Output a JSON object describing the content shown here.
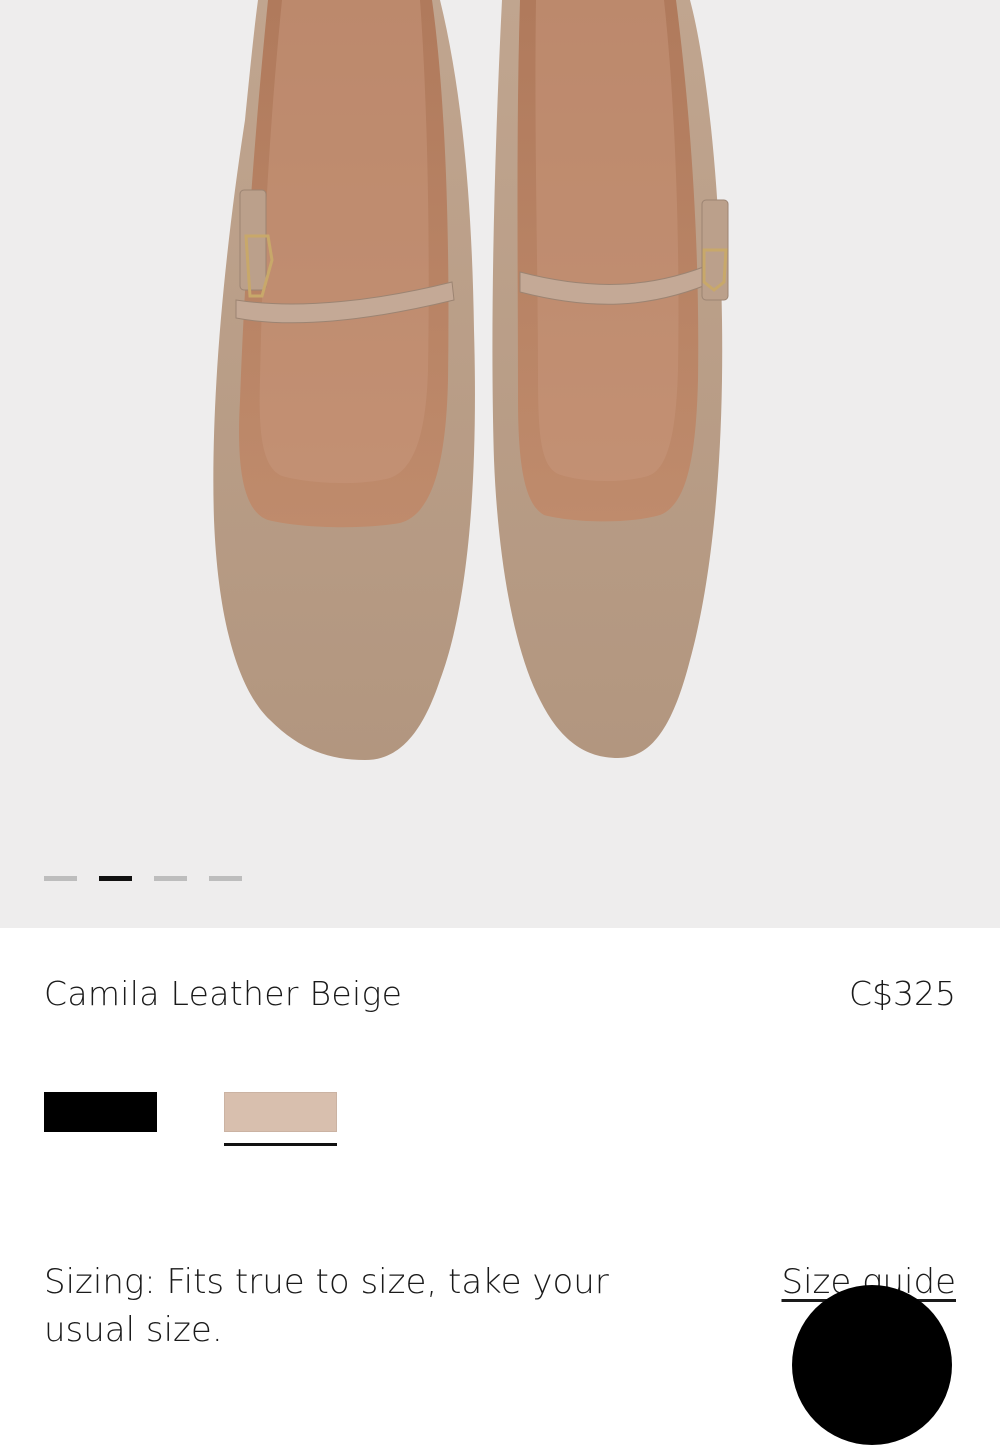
{
  "product": {
    "name": "Camila Leather Beige",
    "price": "C$325"
  },
  "gallery": {
    "slide_count": 4,
    "active_slide": 2
  },
  "colors": {
    "swatches": [
      {
        "name": "black",
        "hex": "#000000",
        "selected": false
      },
      {
        "name": "beige",
        "hex": "#d8bfae",
        "selected": true
      }
    ],
    "gallery_background": "#eeeded",
    "shoe_leather": "#b79b85",
    "shoe_lining": "#b9876a"
  },
  "sizing": {
    "line1": "Sizing: Fits true to size, take your",
    "line2": "usual size.",
    "size_guide_label": "Size guide"
  }
}
